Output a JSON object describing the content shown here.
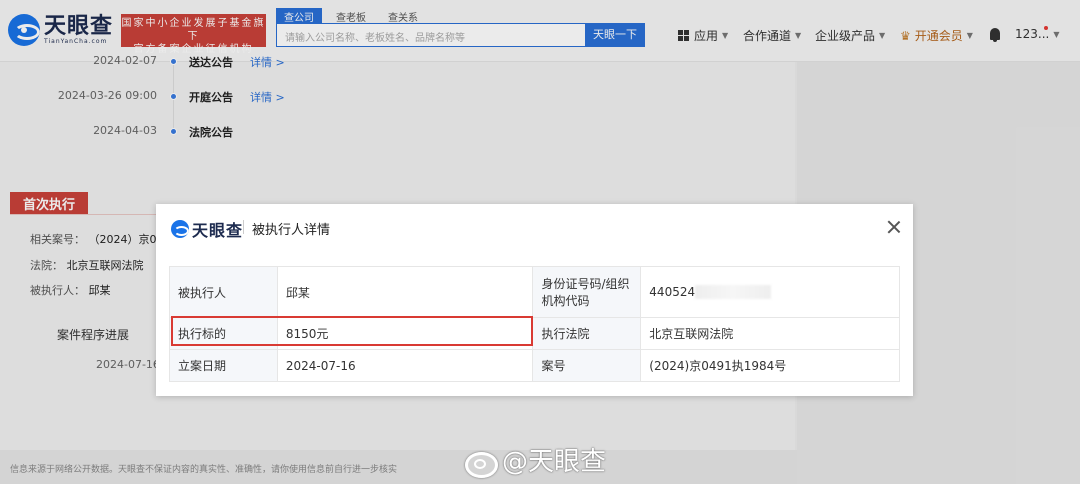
{
  "header": {
    "logo_title": "天眼查",
    "logo_sub": "TianYanCha.com",
    "banner_line1": "国家中小企业发展子基金旗下",
    "banner_line2": "官方备案企业征信机构",
    "search_tabs": [
      "查公司",
      "查老板",
      "查关系"
    ],
    "search_placeholder": "请输入公司名称、老板姓名、品牌名称等",
    "search_button": "天眼一下",
    "nav": {
      "apps": "应用",
      "cooperation": "合作通道",
      "enterprise": "企业级产品",
      "vip": "开通会员",
      "user": "123..."
    }
  },
  "timeline": [
    {
      "date": "2024-02-07",
      "title": "送达公告",
      "link": "详情 >"
    },
    {
      "date": "2024-03-26 09:00",
      "title": "开庭公告",
      "link": "详情 >"
    },
    {
      "date": "2024-04-03",
      "title": "法院公告",
      "link": ""
    }
  ],
  "background_section": {
    "heading": "首次执行",
    "case_label": "相关案号：",
    "case_value": "（2024）京0",
    "court_label": "法院：",
    "court_value": "北京互联网法院",
    "executed_label": "被执行人：",
    "executed_value": "邱某",
    "progress_label": "案件程序进展",
    "progress_date": "2024-07-16",
    "disclaimer": "信息来源于网络公开数据。天眼查不保证内容的真实性、准确性，请你使用信息前自行进一步核实"
  },
  "modal": {
    "logo_text": "天眼查",
    "title": "被执行人详情",
    "rows": [
      {
        "l1": "被执行人",
        "v1": "邱某",
        "l2": "身份证号码/组织机构代码",
        "v2": "440524"
      },
      {
        "l1": "执行标的",
        "v1": "8150元",
        "l2": "执行法院",
        "v2": "北京互联网法院"
      },
      {
        "l1": "立案日期",
        "v1": "2024-07-16",
        "l2": "案号",
        "v2": "(2024)京0491执1984号"
      }
    ]
  },
  "watermark": "@天眼查"
}
